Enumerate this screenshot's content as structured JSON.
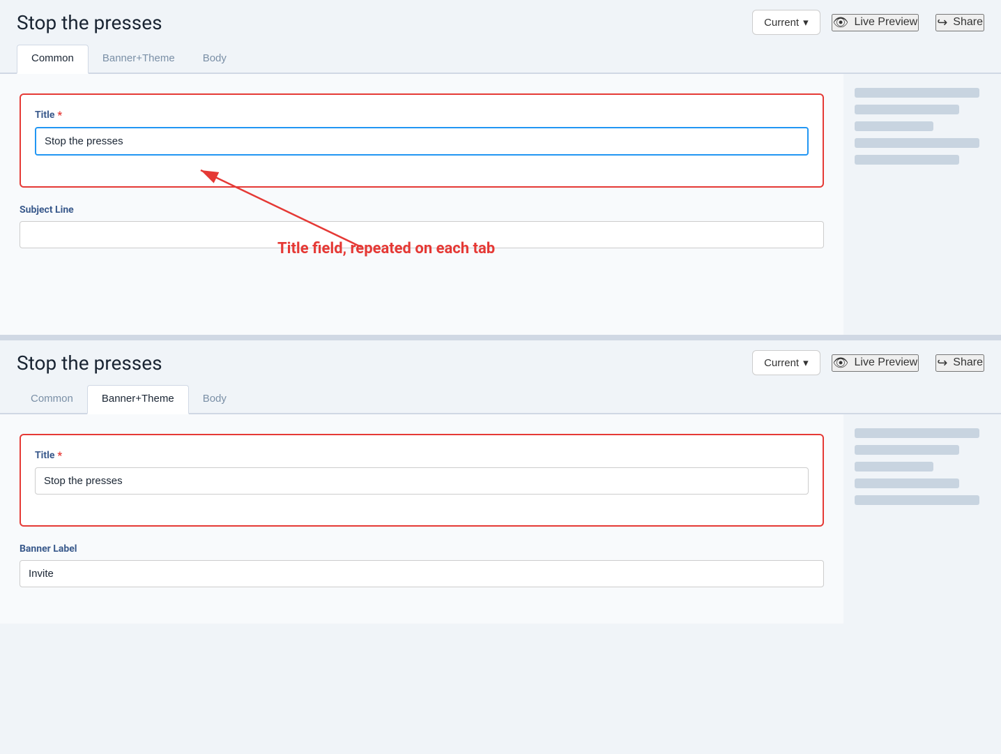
{
  "panel1": {
    "title": "Stop the presses",
    "current_btn": "Current",
    "chevron": "▾",
    "live_preview": "Live Preview",
    "share": "Share",
    "tabs": [
      {
        "label": "Common",
        "active": true
      },
      {
        "label": "Banner+Theme",
        "active": false
      },
      {
        "label": "Body",
        "active": false
      }
    ],
    "title_field": {
      "label": "Title",
      "required": true,
      "value": "Stop the presses",
      "focused": true
    },
    "subject_line_field": {
      "label": "Subject Line",
      "required": false,
      "value": "",
      "placeholder": ""
    }
  },
  "annotation": {
    "text": "Title field, repeated on each tab"
  },
  "panel2": {
    "title": "Stop the presses",
    "current_btn": "Current",
    "chevron": "▾",
    "live_preview": "Live Preview",
    "share": "Share",
    "tabs": [
      {
        "label": "Common",
        "active": false
      },
      {
        "label": "Banner+Theme",
        "active": true
      },
      {
        "label": "Body",
        "active": false
      }
    ],
    "title_field": {
      "label": "Title",
      "required": true,
      "value": "Stop the presses"
    },
    "banner_label_field": {
      "label": "Banner Label",
      "required": false,
      "value": "Invite"
    }
  },
  "icons": {
    "eye": "👁",
    "share": "↪",
    "chevron_down": "∨"
  },
  "sidebar": {
    "lines_top": [
      "long",
      "medium",
      "short",
      "long",
      "medium"
    ],
    "lines_bottom": [
      "long",
      "medium",
      "short",
      "medium",
      "long"
    ]
  }
}
